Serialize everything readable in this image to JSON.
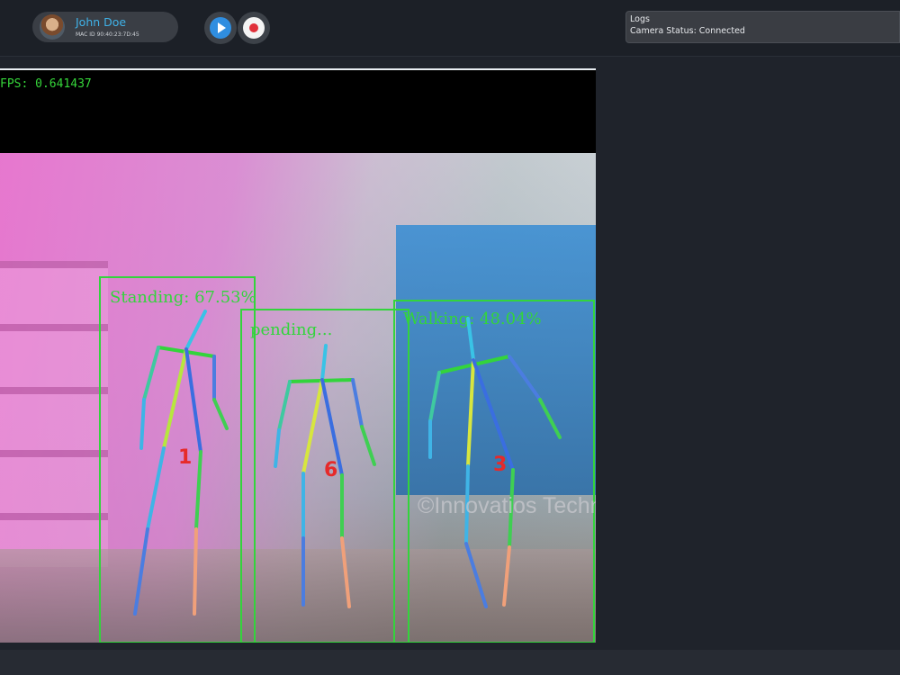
{
  "user": {
    "name": "John Doe",
    "mac_id": "MAC ID 90:40:23:7D:45"
  },
  "controls": {
    "play_icon": "play-icon",
    "record_icon": "record-icon"
  },
  "logs": {
    "title": "Logs",
    "camera_status": "Camera Status: Connected"
  },
  "video": {
    "fps_text": "FPS: 0.641437",
    "watermark": "©Innovatios Technology",
    "detections": [
      {
        "label": "Standing: 67.53%",
        "id": "1"
      },
      {
        "label": "pending...",
        "id": "6"
      },
      {
        "label": "Walking: 48.04%",
        "id": "3"
      }
    ]
  },
  "colors": {
    "accent_blue": "#3fb2e8",
    "box_green": "#33d43c",
    "id_red": "#e62a2a",
    "record_red": "#e0303a"
  }
}
